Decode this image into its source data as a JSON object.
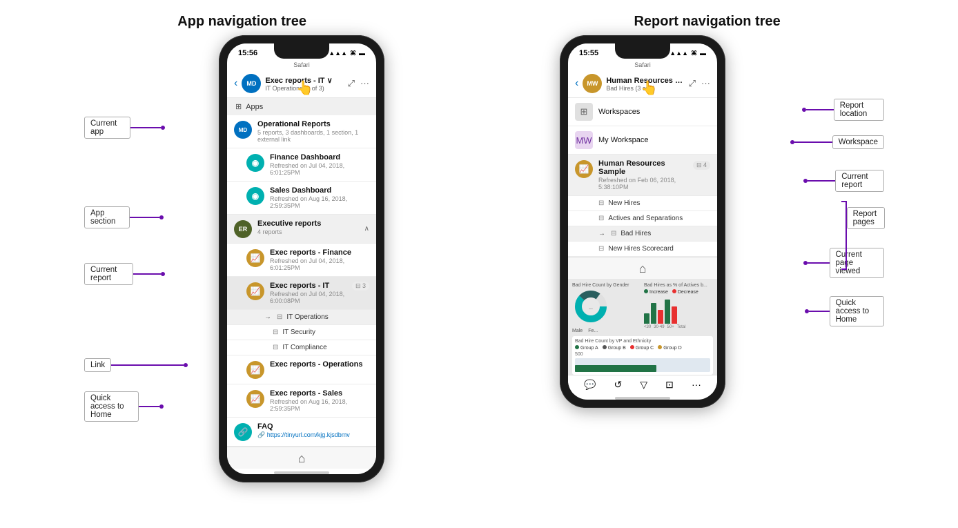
{
  "leftPhone": {
    "title": "App navigation tree",
    "statusBar": {
      "time": "15:56",
      "carrier": "Safari",
      "signal": "▲▲▲",
      "wifi": "wifi",
      "battery": "battery"
    },
    "appBar": {
      "back": "‹",
      "avatarText": "MD",
      "title": "Exec reports - IT ∨",
      "subtitle": "IT Operations (1 of 3)",
      "icon1": "⤢",
      "icon2": "···"
    },
    "navSectionLabel": "Apps",
    "items": [
      {
        "type": "main",
        "avatarText": "MD",
        "avatarColor": "blue",
        "title": "Operational Reports",
        "subtitle": "5 reports, 3 dashboards, 1 section, 1 external link"
      },
      {
        "type": "sub",
        "avatarText": "📊",
        "avatarColor": "teal-dark",
        "title": "Finance Dashboard",
        "subtitle": "Refreshed on Jul 04, 2018, 6:01:25PM",
        "indent": 1
      },
      {
        "type": "sub",
        "avatarText": "📊",
        "avatarColor": "teal-dark",
        "title": "Sales Dashboard",
        "subtitle": "Refreshed on Aug 16, 2018, 2:59:35PM",
        "indent": 1
      },
      {
        "type": "section",
        "avatarText": "ER",
        "avatarColor": "er",
        "title": "Executive reports",
        "subtitle": "4 reports"
      },
      {
        "type": "sub",
        "avatarText": "📈",
        "avatarColor": "gold",
        "title": "Exec reports - Finance",
        "subtitle": "Refreshed on Jul 04, 2018, 6:01:25PM",
        "indent": 1
      },
      {
        "type": "current",
        "avatarText": "📈",
        "avatarColor": "gold",
        "title": "Exec reports - IT",
        "subtitle": "Refreshed on Jul 04, 2018, 6:00:08PM",
        "pages": "3",
        "indent": 1
      },
      {
        "type": "page",
        "title": "IT Operations",
        "current": true,
        "indent": 2
      },
      {
        "type": "page",
        "title": "IT Security",
        "current": false,
        "indent": 2
      },
      {
        "type": "page",
        "title": "IT Compliance",
        "current": false,
        "indent": 2
      },
      {
        "type": "sub",
        "avatarText": "📈",
        "avatarColor": "gold",
        "title": "Exec reports - Operations",
        "subtitle": "",
        "indent": 1
      },
      {
        "type": "sub",
        "avatarText": "📈",
        "avatarColor": "gold",
        "title": "Exec reports - Sales",
        "subtitle": "Refreshed on Aug 16, 2018, 2:59:35PM",
        "indent": 1
      },
      {
        "type": "link",
        "avatarText": "🔗",
        "avatarColor": "teal-dark",
        "title": "FAQ",
        "linkUrl": "https://tinyurl.com/kjg.kjsdbmv",
        "indent": 0
      }
    ],
    "homeLabel": "⌂"
  },
  "rightPhone": {
    "title": "Report navigation tree",
    "statusBar": {
      "time": "15:55",
      "carrier": "Safari",
      "signal": "▲▲▲",
      "wifi": "wifi",
      "battery": "battery"
    },
    "appBar": {
      "back": "‹",
      "avatarText": "MW",
      "avatarColor": "gold",
      "title": "Human Resources Sample ∨",
      "subtitle": "Bad Hires (3 of 4)",
      "icon1": "⤢",
      "icon2": "···"
    },
    "workspaceLabel": "Workspaces",
    "myWorkspace": "My Workspace",
    "reportItem": {
      "title": "Human Resources Sample",
      "subtitle": "Refreshed on Feb 06, 2018, 5:38:10PM",
      "pages": "4"
    },
    "reportPages": [
      {
        "title": "New Hires",
        "current": false
      },
      {
        "title": "Actives and Separations",
        "current": false
      },
      {
        "title": "Bad Hires",
        "current": true
      },
      {
        "title": "New Hires Scorecard",
        "current": false
      }
    ],
    "homeLabel": "⌂",
    "charts": {
      "chart1Title": "Bad Hire Count by Gender",
      "chart2Title": "Bad Hires as % of Actives b...",
      "legend1": [
        {
          "label": "Increase",
          "color": "#217346"
        },
        {
          "label": "Decrease",
          "color": "#e83030"
        }
      ],
      "chart3Title": "Bad Hire Count by VP and Ethnicity",
      "chart3Legend": [
        {
          "label": "Group A",
          "color": "#217346"
        },
        {
          "label": "Group B",
          "color": "#555"
        },
        {
          "label": "Group C",
          "color": "#e83030"
        },
        {
          "label": "Group D",
          "color": "#c8962b"
        }
      ]
    }
  },
  "annotations": {
    "left": {
      "currentApp": "Current app",
      "appSection": "App section",
      "currentReport": "Current report",
      "link": "Link",
      "quickAccessHome": "Quick access to Home"
    },
    "right": {
      "reportLocation": "Report location",
      "currentReport": "Current report",
      "workspace": "Workspace",
      "currentPageViewed": "Current page viewed",
      "quickAccessHome": "Quick access to Home",
      "reportPages": "Report pages"
    }
  }
}
